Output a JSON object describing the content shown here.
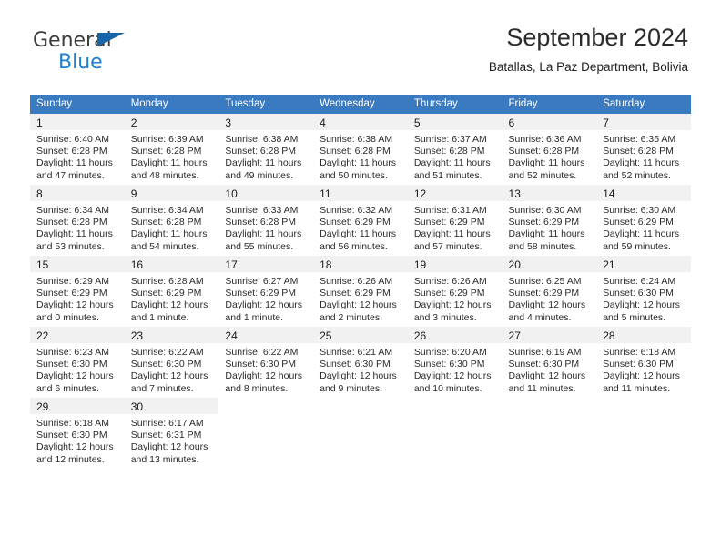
{
  "brand": {
    "line1": "General",
    "line2": "Blue",
    "flag_icon": "blue-triangle-flag-icon",
    "accent_color": "#1f7fd0"
  },
  "header": {
    "title": "September 2024",
    "subtitle": "Batallas, La Paz Department, Bolivia"
  },
  "theme": {
    "header_blue": "#3a7ac0",
    "separator_blue": "#4a82c4",
    "daynum_band": "#f1f1f1"
  },
  "calendar": {
    "weekday_headers": [
      "Sunday",
      "Monday",
      "Tuesday",
      "Wednesday",
      "Thursday",
      "Friday",
      "Saturday"
    ],
    "weeks": [
      [
        {
          "day": "1",
          "sunrise": "Sunrise: 6:40 AM",
          "sunset": "Sunset: 6:28 PM",
          "daylight1": "Daylight: 11 hours",
          "daylight2": "and 47 minutes."
        },
        {
          "day": "2",
          "sunrise": "Sunrise: 6:39 AM",
          "sunset": "Sunset: 6:28 PM",
          "daylight1": "Daylight: 11 hours",
          "daylight2": "and 48 minutes."
        },
        {
          "day": "3",
          "sunrise": "Sunrise: 6:38 AM",
          "sunset": "Sunset: 6:28 PM",
          "daylight1": "Daylight: 11 hours",
          "daylight2": "and 49 minutes."
        },
        {
          "day": "4",
          "sunrise": "Sunrise: 6:38 AM",
          "sunset": "Sunset: 6:28 PM",
          "daylight1": "Daylight: 11 hours",
          "daylight2": "and 50 minutes."
        },
        {
          "day": "5",
          "sunrise": "Sunrise: 6:37 AM",
          "sunset": "Sunset: 6:28 PM",
          "daylight1": "Daylight: 11 hours",
          "daylight2": "and 51 minutes."
        },
        {
          "day": "6",
          "sunrise": "Sunrise: 6:36 AM",
          "sunset": "Sunset: 6:28 PM",
          "daylight1": "Daylight: 11 hours",
          "daylight2": "and 52 minutes."
        },
        {
          "day": "7",
          "sunrise": "Sunrise: 6:35 AM",
          "sunset": "Sunset: 6:28 PM",
          "daylight1": "Daylight: 11 hours",
          "daylight2": "and 52 minutes."
        }
      ],
      [
        {
          "day": "8",
          "sunrise": "Sunrise: 6:34 AM",
          "sunset": "Sunset: 6:28 PM",
          "daylight1": "Daylight: 11 hours",
          "daylight2": "and 53 minutes."
        },
        {
          "day": "9",
          "sunrise": "Sunrise: 6:34 AM",
          "sunset": "Sunset: 6:28 PM",
          "daylight1": "Daylight: 11 hours",
          "daylight2": "and 54 minutes."
        },
        {
          "day": "10",
          "sunrise": "Sunrise: 6:33 AM",
          "sunset": "Sunset: 6:28 PM",
          "daylight1": "Daylight: 11 hours",
          "daylight2": "and 55 minutes."
        },
        {
          "day": "11",
          "sunrise": "Sunrise: 6:32 AM",
          "sunset": "Sunset: 6:29 PM",
          "daylight1": "Daylight: 11 hours",
          "daylight2": "and 56 minutes."
        },
        {
          "day": "12",
          "sunrise": "Sunrise: 6:31 AM",
          "sunset": "Sunset: 6:29 PM",
          "daylight1": "Daylight: 11 hours",
          "daylight2": "and 57 minutes."
        },
        {
          "day": "13",
          "sunrise": "Sunrise: 6:30 AM",
          "sunset": "Sunset: 6:29 PM",
          "daylight1": "Daylight: 11 hours",
          "daylight2": "and 58 minutes."
        },
        {
          "day": "14",
          "sunrise": "Sunrise: 6:30 AM",
          "sunset": "Sunset: 6:29 PM",
          "daylight1": "Daylight: 11 hours",
          "daylight2": "and 59 minutes."
        }
      ],
      [
        {
          "day": "15",
          "sunrise": "Sunrise: 6:29 AM",
          "sunset": "Sunset: 6:29 PM",
          "daylight1": "Daylight: 12 hours",
          "daylight2": "and 0 minutes."
        },
        {
          "day": "16",
          "sunrise": "Sunrise: 6:28 AM",
          "sunset": "Sunset: 6:29 PM",
          "daylight1": "Daylight: 12 hours",
          "daylight2": "and 1 minute."
        },
        {
          "day": "17",
          "sunrise": "Sunrise: 6:27 AM",
          "sunset": "Sunset: 6:29 PM",
          "daylight1": "Daylight: 12 hours",
          "daylight2": "and 1 minute."
        },
        {
          "day": "18",
          "sunrise": "Sunrise: 6:26 AM",
          "sunset": "Sunset: 6:29 PM",
          "daylight1": "Daylight: 12 hours",
          "daylight2": "and 2 minutes."
        },
        {
          "day": "19",
          "sunrise": "Sunrise: 6:26 AM",
          "sunset": "Sunset: 6:29 PM",
          "daylight1": "Daylight: 12 hours",
          "daylight2": "and 3 minutes."
        },
        {
          "day": "20",
          "sunrise": "Sunrise: 6:25 AM",
          "sunset": "Sunset: 6:29 PM",
          "daylight1": "Daylight: 12 hours",
          "daylight2": "and 4 minutes."
        },
        {
          "day": "21",
          "sunrise": "Sunrise: 6:24 AM",
          "sunset": "Sunset: 6:30 PM",
          "daylight1": "Daylight: 12 hours",
          "daylight2": "and 5 minutes."
        }
      ],
      [
        {
          "day": "22",
          "sunrise": "Sunrise: 6:23 AM",
          "sunset": "Sunset: 6:30 PM",
          "daylight1": "Daylight: 12 hours",
          "daylight2": "and 6 minutes."
        },
        {
          "day": "23",
          "sunrise": "Sunrise: 6:22 AM",
          "sunset": "Sunset: 6:30 PM",
          "daylight1": "Daylight: 12 hours",
          "daylight2": "and 7 minutes."
        },
        {
          "day": "24",
          "sunrise": "Sunrise: 6:22 AM",
          "sunset": "Sunset: 6:30 PM",
          "daylight1": "Daylight: 12 hours",
          "daylight2": "and 8 minutes."
        },
        {
          "day": "25",
          "sunrise": "Sunrise: 6:21 AM",
          "sunset": "Sunset: 6:30 PM",
          "daylight1": "Daylight: 12 hours",
          "daylight2": "and 9 minutes."
        },
        {
          "day": "26",
          "sunrise": "Sunrise: 6:20 AM",
          "sunset": "Sunset: 6:30 PM",
          "daylight1": "Daylight: 12 hours",
          "daylight2": "and 10 minutes."
        },
        {
          "day": "27",
          "sunrise": "Sunrise: 6:19 AM",
          "sunset": "Sunset: 6:30 PM",
          "daylight1": "Daylight: 12 hours",
          "daylight2": "and 11 minutes."
        },
        {
          "day": "28",
          "sunrise": "Sunrise: 6:18 AM",
          "sunset": "Sunset: 6:30 PM",
          "daylight1": "Daylight: 12 hours",
          "daylight2": "and 11 minutes."
        }
      ],
      [
        {
          "day": "29",
          "sunrise": "Sunrise: 6:18 AM",
          "sunset": "Sunset: 6:30 PM",
          "daylight1": "Daylight: 12 hours",
          "daylight2": "and 12 minutes."
        },
        {
          "day": "30",
          "sunrise": "Sunrise: 6:17 AM",
          "sunset": "Sunset: 6:31 PM",
          "daylight1": "Daylight: 12 hours",
          "daylight2": "and 13 minutes."
        },
        {
          "day": "",
          "sunrise": "",
          "sunset": "",
          "daylight1": "",
          "daylight2": ""
        },
        {
          "day": "",
          "sunrise": "",
          "sunset": "",
          "daylight1": "",
          "daylight2": ""
        },
        {
          "day": "",
          "sunrise": "",
          "sunset": "",
          "daylight1": "",
          "daylight2": ""
        },
        {
          "day": "",
          "sunrise": "",
          "sunset": "",
          "daylight1": "",
          "daylight2": ""
        },
        {
          "day": "",
          "sunrise": "",
          "sunset": "",
          "daylight1": "",
          "daylight2": ""
        }
      ]
    ]
  }
}
